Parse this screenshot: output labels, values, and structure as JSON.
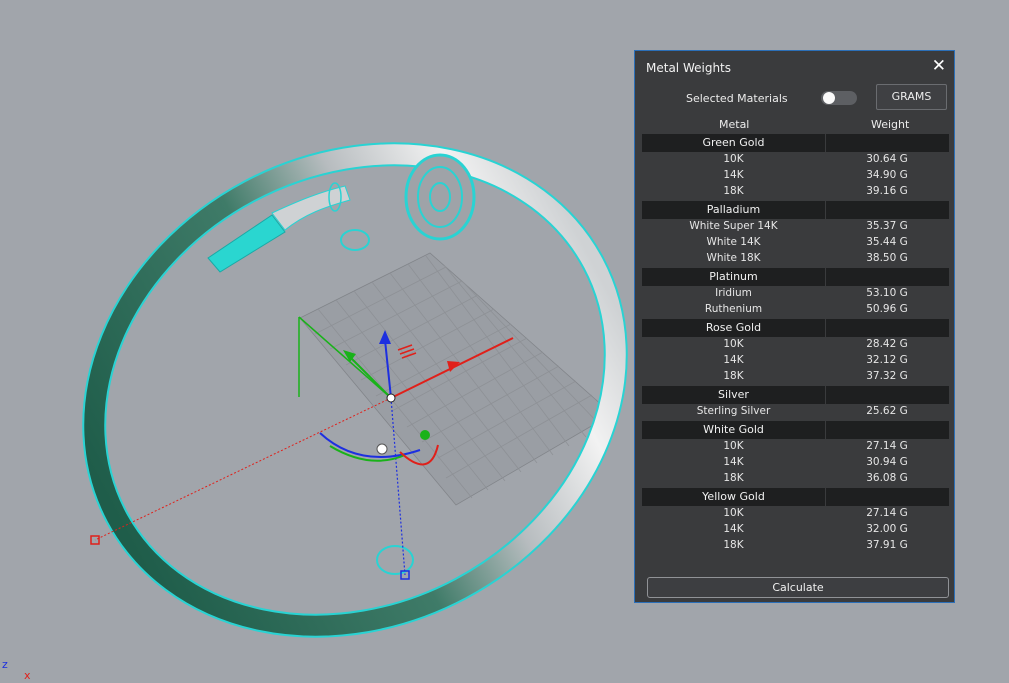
{
  "panel": {
    "title": "Metal Weights",
    "close_icon": "close-icon",
    "selected_materials_label": "Selected Materials",
    "selected_materials_on": false,
    "units_button": "GRAMS",
    "col_metal": "Metal",
    "col_weight": "Weight",
    "calculate_label": "Calculate"
  },
  "groups": [
    {
      "name": "Green Gold",
      "items": [
        {
          "name": "10K",
          "weight": "30.64 G"
        },
        {
          "name": "14K",
          "weight": "34.90 G"
        },
        {
          "name": "18K",
          "weight": "39.16 G"
        }
      ]
    },
    {
      "name": "Palladium",
      "items": [
        {
          "name": "White Super 14K",
          "weight": "35.37 G"
        },
        {
          "name": "White 14K",
          "weight": "35.44 G"
        },
        {
          "name": "White 18K",
          "weight": "38.50 G"
        }
      ]
    },
    {
      "name": "Platinum",
      "items": [
        {
          "name": "Iridium",
          "weight": "53.10 G"
        },
        {
          "name": "Ruthenium",
          "weight": "50.96 G"
        }
      ]
    },
    {
      "name": "Rose Gold",
      "items": [
        {
          "name": "10K",
          "weight": "28.42 G"
        },
        {
          "name": "14K",
          "weight": "32.12 G"
        },
        {
          "name": "18K",
          "weight": "37.32 G"
        }
      ]
    },
    {
      "name": "Silver",
      "items": [
        {
          "name": "Sterling Silver",
          "weight": "25.62 G"
        }
      ]
    },
    {
      "name": "White Gold",
      "items": [
        {
          "name": "10K",
          "weight": "27.14 G"
        },
        {
          "name": "14K",
          "weight": "30.94 G"
        },
        {
          "name": "18K",
          "weight": "36.08 G"
        }
      ]
    },
    {
      "name": "Yellow Gold",
      "items": [
        {
          "name": "10K",
          "weight": "27.14 G"
        },
        {
          "name": "14K",
          "weight": "32.00 G"
        },
        {
          "name": "18K",
          "weight": "37.91 G"
        }
      ]
    }
  ],
  "axis_indicator": {
    "z_label": "z",
    "x_label": "x"
  },
  "colors": {
    "viewport_bg": "#a1a5ab",
    "panel_bg": "#3a3b3d",
    "group_bg": "#1e1f20",
    "selection_cyan": "#29d3d3",
    "axis_red": "#e0201a",
    "axis_green": "#19b219",
    "axis_blue": "#1d2fe0"
  }
}
